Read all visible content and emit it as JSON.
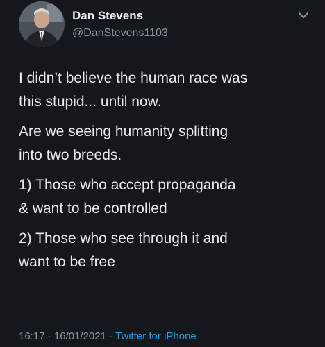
{
  "author": {
    "display_name": "Dan Stevens",
    "handle": "@DanStevens1103",
    "avatar_icon": "profile-photo"
  },
  "header": {
    "menu_icon": "chevron-down-icon"
  },
  "tweet": {
    "paragraphs": [
      "I didn’t believe the human race was\nthis stupid... until now.",
      "Are we seeing humanity splitting\ninto two breeds.",
      "1) Those who accept propaganda\n& want to be controlled",
      "2) Those who see through it and\nwant to be free"
    ]
  },
  "footer": {
    "time": "16:17",
    "separator": "·",
    "date": "16/01/2021",
    "source": "Twitter for iPhone"
  },
  "colors": {
    "background": "#14171c",
    "text": "#e9ebed",
    "secondary": "#8b98a5",
    "link": "#1d9bf0"
  }
}
